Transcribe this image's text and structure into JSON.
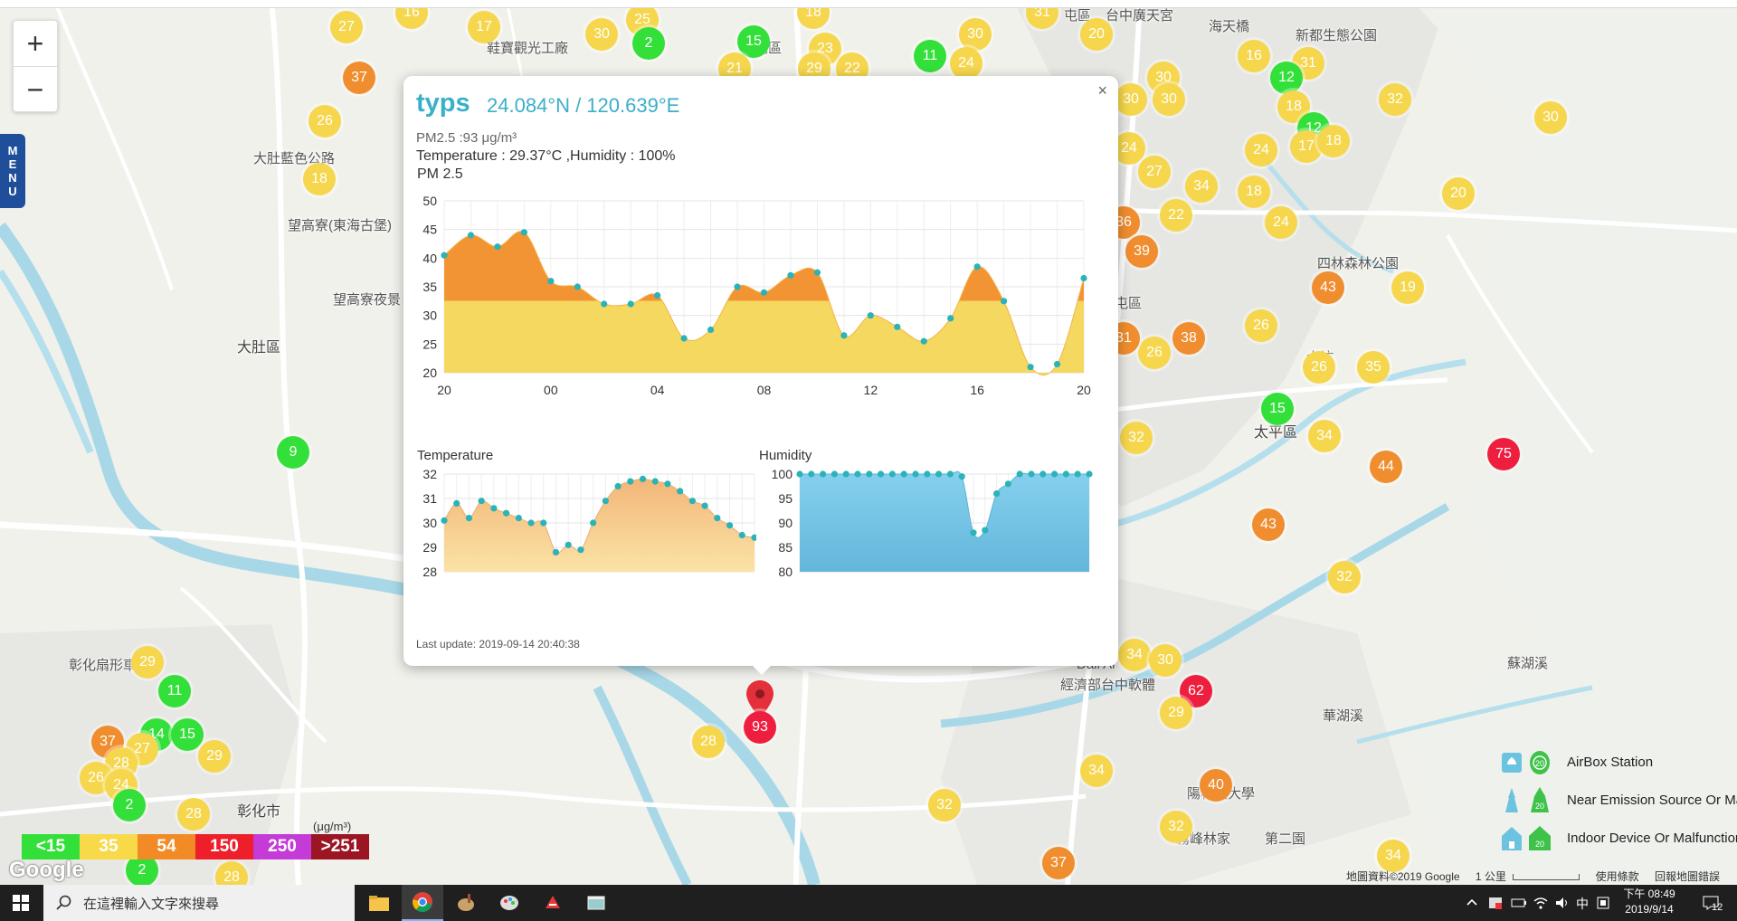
{
  "map": {
    "labels": [
      {
        "text": "大肚區",
        "x": 262,
        "y": 380,
        "big": true
      },
      {
        "text": "大肚藍色公路",
        "x": 280,
        "y": 174
      },
      {
        "text": "望高寮(東海古堡)",
        "x": 318,
        "y": 248
      },
      {
        "text": "望高寮夜景",
        "x": 368,
        "y": 330
      },
      {
        "text": "彰化扇形車",
        "x": 76,
        "y": 734
      },
      {
        "text": "彰化市",
        "x": 262,
        "y": 893,
        "big": true
      },
      {
        "text": "太平區",
        "x": 1386,
        "y": 474,
        "big": true
      },
      {
        "text": "屯區",
        "x": 1176,
        "y": 16
      },
      {
        "text": "台中廣天宮",
        "x": 1222,
        "y": 16
      },
      {
        "text": "海天橋",
        "x": 1336,
        "y": 28
      },
      {
        "text": "新都生態公園",
        "x": 1432,
        "y": 38
      },
      {
        "text": "四林森林公園",
        "x": 1456,
        "y": 290
      },
      {
        "text": "大坑",
        "x": 1444,
        "y": 394
      },
      {
        "text": "霧峰林家",
        "x": 1300,
        "y": 926
      },
      {
        "text": "第二園",
        "x": 1398,
        "y": 926
      },
      {
        "text": "陽科技大學",
        "x": 1312,
        "y": 876
      },
      {
        "text": "經濟部台中軟體",
        "x": 1172,
        "y": 756
      },
      {
        "text": "華湖溪",
        "x": 1462,
        "y": 790
      },
      {
        "text": "蘇湖溪",
        "x": 1666,
        "y": 732
      },
      {
        "text": "鞋寶觀光工廠",
        "x": 538,
        "y": 52
      },
      {
        "text": "屯區",
        "x": 834,
        "y": 52
      },
      {
        "text": "Dali Ar",
        "x": 1190,
        "y": 736
      },
      {
        "text": "屯區",
        "x": 1232,
        "y": 334
      }
    ],
    "markers": [
      {
        "v": "27",
        "c": "yellow",
        "x": 383,
        "y": 30
      },
      {
        "v": "16",
        "c": "yellow",
        "x": 455,
        "y": 14
      },
      {
        "v": "17",
        "c": "yellow",
        "x": 535,
        "y": 30
      },
      {
        "v": "30",
        "c": "yellow",
        "x": 665,
        "y": 38
      },
      {
        "v": "25",
        "c": "yellow",
        "x": 710,
        "y": 22
      },
      {
        "v": "2",
        "c": "green",
        "x": 717,
        "y": 48
      },
      {
        "v": "15",
        "c": "green",
        "x": 833,
        "y": 46
      },
      {
        "v": "18",
        "c": "yellow",
        "x": 899,
        "y": 14
      },
      {
        "v": "23",
        "c": "yellow",
        "x": 912,
        "y": 54
      },
      {
        "v": "21",
        "c": "yellow",
        "x": 812,
        "y": 76
      },
      {
        "v": "29",
        "c": "yellow",
        "x": 900,
        "y": 76
      },
      {
        "v": "22",
        "c": "yellow",
        "x": 942,
        "y": 76
      },
      {
        "v": "11",
        "c": "green",
        "x": 1028,
        "y": 62
      },
      {
        "v": "30",
        "c": "yellow",
        "x": 1078,
        "y": 38
      },
      {
        "v": "24",
        "c": "yellow",
        "x": 1068,
        "y": 70
      },
      {
        "v": "31",
        "c": "yellow",
        "x": 1152,
        "y": 14
      },
      {
        "v": "20",
        "c": "yellow",
        "x": 1212,
        "y": 38
      },
      {
        "v": "37",
        "c": "orange",
        "x": 397,
        "y": 86
      },
      {
        "v": "26",
        "c": "yellow",
        "x": 359,
        "y": 134
      },
      {
        "v": "18",
        "c": "yellow",
        "x": 353,
        "y": 198
      },
      {
        "v": "9",
        "c": "green",
        "x": 324,
        "y": 500
      },
      {
        "v": "30",
        "c": "yellow",
        "x": 1286,
        "y": 86
      },
      {
        "v": "30",
        "c": "yellow",
        "x": 1292,
        "y": 110
      },
      {
        "v": "30",
        "c": "yellow",
        "x": 1250,
        "y": 110
      },
      {
        "v": "16",
        "c": "yellow",
        "x": 1386,
        "y": 62
      },
      {
        "v": "31",
        "c": "yellow",
        "x": 1446,
        "y": 70
      },
      {
        "v": "12",
        "c": "green",
        "x": 1422,
        "y": 86
      },
      {
        "v": "18",
        "c": "yellow",
        "x": 1430,
        "y": 118
      },
      {
        "v": "12",
        "c": "green",
        "x": 1452,
        "y": 142
      },
      {
        "v": "17",
        "c": "yellow",
        "x": 1444,
        "y": 162
      },
      {
        "v": "18",
        "c": "yellow",
        "x": 1474,
        "y": 156
      },
      {
        "v": "32",
        "c": "yellow",
        "x": 1542,
        "y": 110
      },
      {
        "v": "30",
        "c": "yellow",
        "x": 1714,
        "y": 130
      },
      {
        "v": "24",
        "c": "yellow",
        "x": 1248,
        "y": 164
      },
      {
        "v": "27",
        "c": "yellow",
        "x": 1276,
        "y": 190
      },
      {
        "v": "34",
        "c": "yellow",
        "x": 1328,
        "y": 206
      },
      {
        "v": "24",
        "c": "yellow",
        "x": 1394,
        "y": 166
      },
      {
        "v": "18",
        "c": "yellow",
        "x": 1386,
        "y": 212
      },
      {
        "v": "22",
        "c": "yellow",
        "x": 1300,
        "y": 238
      },
      {
        "v": "24",
        "c": "yellow",
        "x": 1416,
        "y": 246
      },
      {
        "v": "20",
        "c": "yellow",
        "x": 1612,
        "y": 214
      },
      {
        "v": "36",
        "c": "orange",
        "x": 1242,
        "y": 246
      },
      {
        "v": "39",
        "c": "orange",
        "x": 1262,
        "y": 278
      },
      {
        "v": "43",
        "c": "orange",
        "x": 1468,
        "y": 318
      },
      {
        "v": "19",
        "c": "yellow",
        "x": 1556,
        "y": 318
      },
      {
        "v": "26",
        "c": "yellow",
        "x": 1394,
        "y": 360
      },
      {
        "v": "38",
        "c": "orange",
        "x": 1314,
        "y": 374
      },
      {
        "v": "26",
        "c": "yellow",
        "x": 1276,
        "y": 390
      },
      {
        "v": "31",
        "c": "orange",
        "x": 1242,
        "y": 374
      },
      {
        "v": "26",
        "c": "yellow",
        "x": 1458,
        "y": 406
      },
      {
        "v": "35",
        "c": "yellow",
        "x": 1518,
        "y": 406
      },
      {
        "v": "15",
        "c": "green",
        "x": 1412,
        "y": 452
      },
      {
        "v": "34",
        "c": "yellow",
        "x": 1464,
        "y": 482
      },
      {
        "v": "32",
        "c": "yellow",
        "x": 1256,
        "y": 484
      },
      {
        "v": "44",
        "c": "orange",
        "x": 1532,
        "y": 516
      },
      {
        "v": "75",
        "c": "red",
        "x": 1662,
        "y": 502
      },
      {
        "v": "43",
        "c": "orange",
        "x": 1402,
        "y": 580
      },
      {
        "v": "32",
        "c": "yellow",
        "x": 1486,
        "y": 638
      },
      {
        "v": "34",
        "c": "yellow",
        "x": 1254,
        "y": 724
      },
      {
        "v": "30",
        "c": "yellow",
        "x": 1288,
        "y": 730
      },
      {
        "v": "62",
        "c": "red",
        "x": 1322,
        "y": 764
      },
      {
        "v": "29",
        "c": "yellow",
        "x": 1300,
        "y": 788
      },
      {
        "v": "34",
        "c": "yellow",
        "x": 1212,
        "y": 852
      },
      {
        "v": "40",
        "c": "orange",
        "x": 1344,
        "y": 868
      },
      {
        "v": "32",
        "c": "yellow",
        "x": 1044,
        "y": 890
      },
      {
        "v": "32",
        "c": "yellow",
        "x": 1300,
        "y": 914
      },
      {
        "v": "37",
        "c": "orange",
        "x": 1170,
        "y": 954
      },
      {
        "v": "34",
        "c": "yellow",
        "x": 1540,
        "y": 946
      },
      {
        "v": "28",
        "c": "yellow",
        "x": 783,
        "y": 820
      },
      {
        "v": "29",
        "c": "yellow",
        "x": 163,
        "y": 732
      },
      {
        "v": "11",
        "c": "green",
        "x": 193,
        "y": 764
      },
      {
        "v": "37",
        "c": "orange",
        "x": 119,
        "y": 820
      },
      {
        "v": "14",
        "c": "green",
        "x": 173,
        "y": 812
      },
      {
        "v": "15",
        "c": "green",
        "x": 207,
        "y": 812
      },
      {
        "v": "27",
        "c": "yellow",
        "x": 157,
        "y": 828
      },
      {
        "v": "28",
        "c": "yellow",
        "x": 134,
        "y": 844
      },
      {
        "v": "29",
        "c": "yellow",
        "x": 237,
        "y": 836
      },
      {
        "v": "26",
        "c": "yellow",
        "x": 106,
        "y": 860
      },
      {
        "v": "24",
        "c": "yellow",
        "x": 134,
        "y": 868
      },
      {
        "v": "2",
        "c": "green",
        "x": 143,
        "y": 890
      },
      {
        "v": "28",
        "c": "yellow",
        "x": 214,
        "y": 900
      },
      {
        "v": "28",
        "c": "yellow",
        "x": 256,
        "y": 970
      },
      {
        "v": "2",
        "c": "green",
        "x": 157,
        "y": 962
      }
    ],
    "selected_marker": {
      "v": "93",
      "c": "red"
    }
  },
  "controls": {
    "zoom_in": "+",
    "zoom_out": "−",
    "menu_letters": [
      "M",
      "E",
      "N",
      "U"
    ]
  },
  "popup": {
    "close": "×",
    "title": "typs",
    "coords": "24.084°N / 120.639°E",
    "pm_line": "PM2.5 :93 μg/m³",
    "temp_line": "Temperature : 29.37°C ,Humidity : 100%",
    "pm_title": "PM 2.5",
    "temp_title": "Temperature",
    "humidity_title": "Humidity",
    "last_update": "Last update: 2019-09-14 20:40:38"
  },
  "chart_data": [
    {
      "type": "area",
      "title": "PM 2.5",
      "x_ticks": [
        "20",
        "00",
        "04",
        "08",
        "12",
        "16",
        "20"
      ],
      "yticks": [
        20,
        25,
        30,
        35,
        40,
        45,
        50
      ],
      "ylim": [
        20,
        50
      ],
      "threshold": 35.5,
      "colors": {
        "low": "#f4d860",
        "high": "#f29433"
      },
      "values": [
        40.5,
        44,
        42,
        44.5,
        36,
        35,
        32,
        32,
        33.5,
        26,
        27.5,
        35,
        34,
        37,
        37.5,
        26.5,
        30,
        28,
        25.5,
        29.5,
        38.5,
        32.5,
        21,
        21.5,
        36.5
      ]
    },
    {
      "type": "area",
      "title": "Temperature",
      "yticks": [
        28,
        29,
        30,
        31,
        32
      ],
      "ylim": [
        28,
        32
      ],
      "values": [
        30.1,
        30.8,
        30.2,
        30.9,
        30.6,
        30.4,
        30.2,
        30.0,
        30.0,
        28.8,
        29.1,
        28.9,
        30.0,
        30.9,
        31.5,
        31.7,
        31.8,
        31.7,
        31.6,
        31.3,
        30.9,
        30.7,
        30.2,
        29.9,
        29.5,
        29.4
      ]
    },
    {
      "type": "area",
      "title": "Humidity",
      "yticks": [
        80,
        85,
        90,
        95,
        100
      ],
      "ylim": [
        80,
        100
      ],
      "values": [
        100,
        100,
        100,
        100,
        100,
        100,
        100,
        100,
        100,
        100,
        100,
        100,
        100,
        100,
        99.5,
        88,
        88.5,
        96,
        98,
        100,
        100,
        100,
        100,
        100,
        100,
        100
      ]
    }
  ],
  "legend": {
    "unit": "(μg/m³)",
    "items": [
      {
        "label": "<15",
        "color": "#33e03a"
      },
      {
        "label": "35",
        "color": "#f7d94a"
      },
      {
        "label": "54",
        "color": "#f28b25"
      },
      {
        "label": "150",
        "color": "#ee1f2a"
      },
      {
        "label": "250",
        "color": "#c43bd8"
      },
      {
        "label": ">251",
        "color": "#9b1622"
      }
    ]
  },
  "status_legend": [
    {
      "label": "AirBox Station"
    },
    {
      "label": "Near Emission Source Or Malfunction"
    },
    {
      "label": "Indoor Device Or Malfunction"
    }
  ],
  "google": {
    "logo": "Google",
    "attribution": "地圖資料©2019 Google",
    "scale": "1 公里",
    "terms": "使用條款",
    "report": "回報地圖錯誤"
  },
  "taskbar": {
    "search_placeholder": "在這裡輸入文字來搜尋",
    "ime": "中",
    "clock_time": "下午 08:49",
    "clock_date": "2019/9/14",
    "notifications": "12"
  }
}
